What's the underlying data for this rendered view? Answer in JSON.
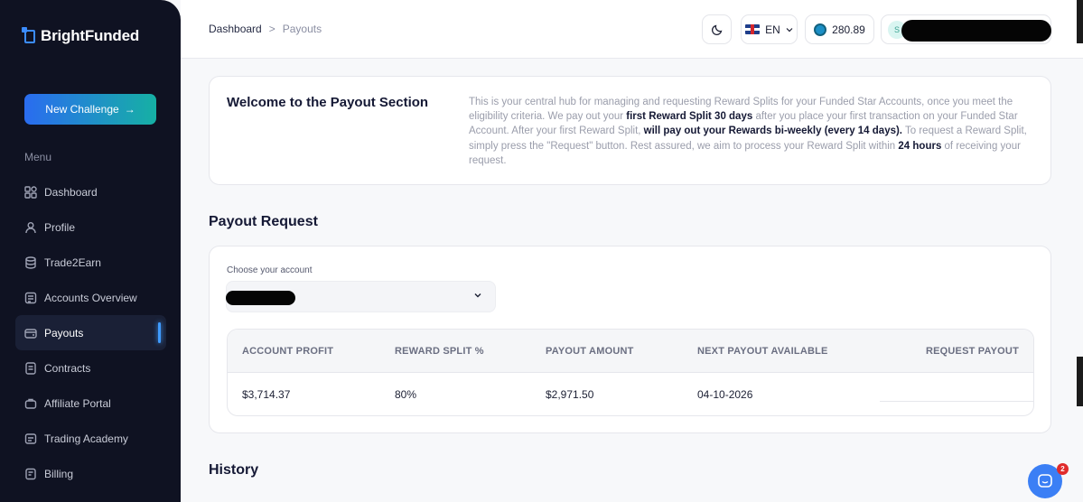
{
  "brand": {
    "name": "BrightFunded"
  },
  "sidebar": {
    "new_challenge_label": "New Challenge",
    "menu_label": "Menu",
    "items": [
      {
        "label": "Dashboard",
        "icon": "dashboard-icon"
      },
      {
        "label": "Profile",
        "icon": "user-icon"
      },
      {
        "label": "Trade2Earn",
        "icon": "coins-icon"
      },
      {
        "label": "Accounts Overview",
        "icon": "accounts-icon"
      },
      {
        "label": "Payouts",
        "icon": "wallet-icon",
        "active": true
      },
      {
        "label": "Contracts",
        "icon": "document-icon"
      },
      {
        "label": "Affiliate Portal",
        "icon": "affiliate-icon"
      },
      {
        "label": "Trading Academy",
        "icon": "academy-icon"
      },
      {
        "label": "Billing",
        "icon": "billing-icon"
      }
    ]
  },
  "header": {
    "breadcrumb": {
      "root": "Dashboard",
      "separator": ">",
      "current": "Payouts"
    },
    "language": "EN",
    "coin_balance": "280.89",
    "user_initial": "S"
  },
  "welcome": {
    "title": "Welcome to the Payout Section",
    "text_1": "This is your central hub for managing and requesting Reward Splits for your Funded Star Accounts, once you meet the eligibility criteria. We pay out your ",
    "bold_1": "first Reward Split 30 days",
    "text_2": " after you place your first transaction on your Funded Star Account. After your first Reward Split, ",
    "bold_2": "will pay out your Rewards bi-weekly (every 14 days).",
    "text_3": " To request a Reward Split, simply press the \"Request\" button. Rest assured, we aim to process your Reward Split within ",
    "bold_3": "24 hours",
    "text_4": " of receiving your request."
  },
  "payout_request": {
    "title": "Payout Request",
    "choose_label": "Choose your account",
    "columns": [
      "ACCOUNT PROFIT",
      "REWARD SPLIT %",
      "PAYOUT AMOUNT",
      "NEXT PAYOUT AVAILABLE",
      "REQUEST PAYOUT"
    ],
    "row": {
      "account_profit": "$3,714.37",
      "reward_split": "80%",
      "payout_amount": "$2,971.50",
      "next_payout": "04-10-2026"
    }
  },
  "history": {
    "title": "History"
  },
  "chat": {
    "badge_count": "2"
  },
  "colors": {
    "sidebar_bg": "#0f1222",
    "accent": "#3b7ff5",
    "gradient_start": "#2a6cf0",
    "gradient_end": "#16b0a4"
  }
}
